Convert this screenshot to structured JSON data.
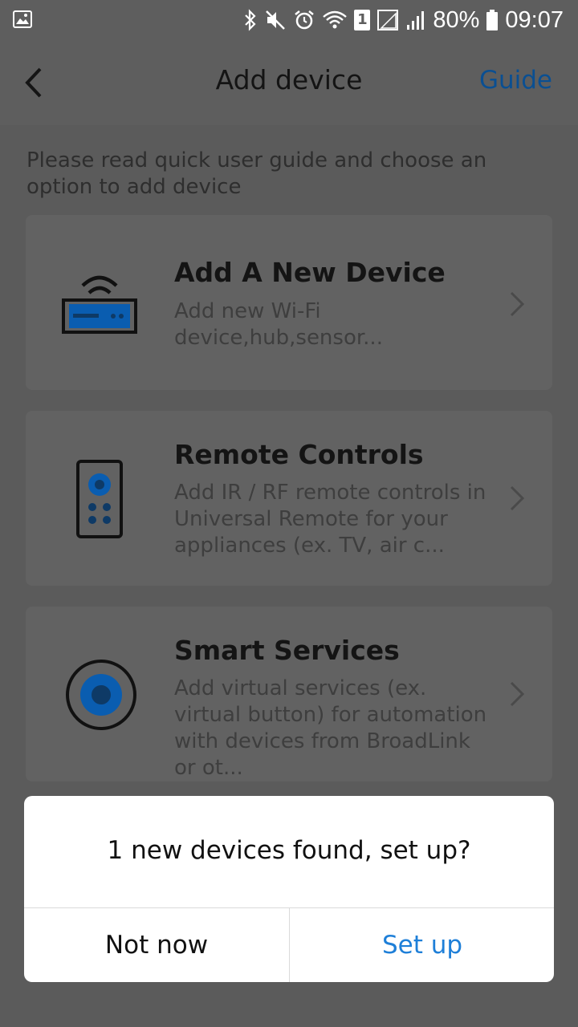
{
  "status_bar": {
    "battery": "80%",
    "time": "09:07",
    "sim_slot": "1"
  },
  "app_bar": {
    "title": "Add device",
    "guide_label": "Guide"
  },
  "hint_text": "Please read quick user guide and choose an option to add device",
  "options": [
    {
      "title": "Add A New Device",
      "description": "Add new Wi-Fi device,hub,sensor...",
      "icon": "wifi-router-icon"
    },
    {
      "title": "Remote Controls",
      "description": "Add IR / RF remote controls in Universal Remote for your appliances (ex. TV, air c...",
      "icon": "remote-control-icon"
    },
    {
      "title": "Smart Services",
      "description": "Add virtual services (ex. virtual button) for automation with devices from BroadLink or ot...",
      "icon": "smart-service-icon"
    }
  ],
  "dialog": {
    "message": "1 new devices found, set up?",
    "not_now_label": "Not now",
    "set_up_label": "Set up"
  },
  "colors": {
    "accent": "#1e7fd8",
    "icon_blue": "#0a5db0",
    "overlay": "#5e5e5e"
  }
}
